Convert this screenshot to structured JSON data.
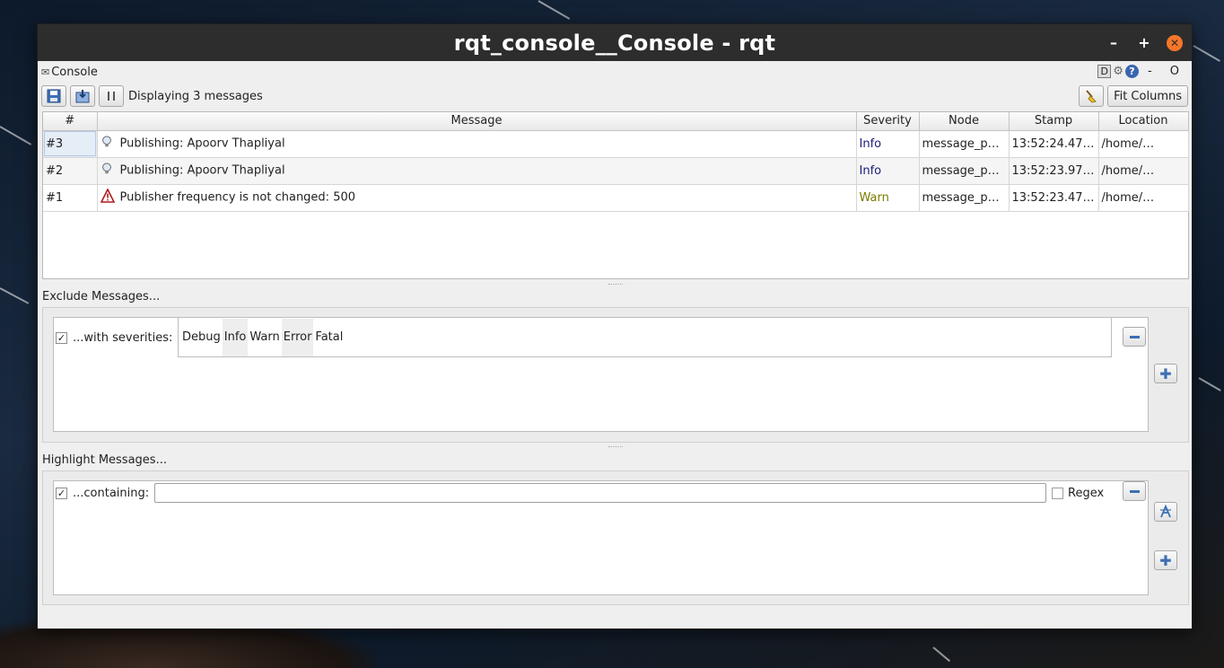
{
  "window": {
    "title": "rqt_console__Console - rqt"
  },
  "plugin": {
    "title": "Console",
    "d_label": "D",
    "help_label": "?",
    "dash_o": "- O"
  },
  "toolbar": {
    "display_count": "Displaying 3 messages",
    "fit_columns": "Fit Columns"
  },
  "table": {
    "headers": [
      "#",
      "Message",
      "Severity",
      "Node",
      "Stamp",
      "Location"
    ],
    "rows": [
      {
        "num": "#3",
        "icon": "info-bulb-icon",
        "message": "Publishing: Apoorv Thapliyal",
        "severity": "Info",
        "node": "message_p…",
        "stamp": "13:52:24.47…",
        "location": "/home/…"
      },
      {
        "num": "#2",
        "icon": "info-bulb-icon",
        "message": "Publishing: Apoorv Thapliyal",
        "severity": "Info",
        "node": "message_p…",
        "stamp": "13:52:23.97…",
        "location": "/home/…"
      },
      {
        "num": "#1",
        "icon": "warning-triangle-icon",
        "message": "Publisher frequency is not changed: 500",
        "severity": "Warn",
        "node": "message_p…",
        "stamp": "13:52:23.47…",
        "location": "/home/…"
      }
    ]
  },
  "exclude": {
    "heading": "Exclude Messages...",
    "checkbox_mark": "✓",
    "filter_label": "...with severities:",
    "severities": [
      "Debug",
      "Info",
      "Warn",
      "Error",
      "Fatal"
    ]
  },
  "highlight": {
    "heading": "Highlight Messages...",
    "checkbox_mark": "✓",
    "filter_label": "...containing:",
    "input_value": "",
    "regex_label": "Regex"
  },
  "colors": {
    "info": "#1c1c7a",
    "warn": "#7b7b00",
    "accent": "#3d6fb4",
    "titlebar": "#2d2d2d",
    "close": "#f5762b"
  }
}
